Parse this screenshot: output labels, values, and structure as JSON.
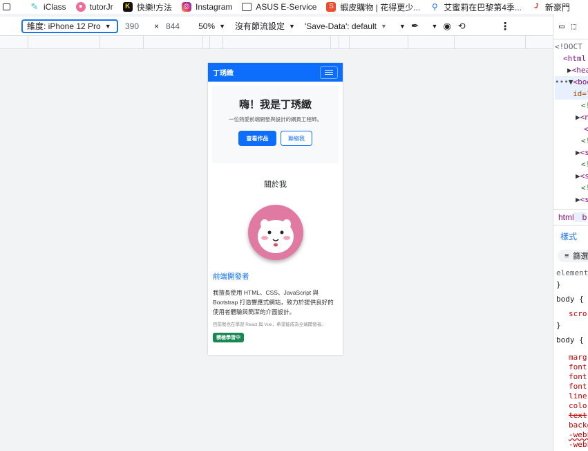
{
  "bookmarks": [
    {
      "label": "",
      "icon": "window-icon",
      "color": "#5f6368"
    },
    {
      "label": "iClass",
      "icon": "iclass-icon",
      "color": "#3db8c8"
    },
    {
      "label": "tutorJr",
      "icon": "tutorjr-icon",
      "color": "#f06a9b"
    },
    {
      "label": "快樂!方法",
      "icon": "kuaile-icon",
      "color": "#222222"
    },
    {
      "label": "Instagram",
      "icon": "instagram-icon",
      "color": "#d6297c"
    },
    {
      "label": "ASUS E-Service",
      "icon": "folder-icon",
      "color": "#5f6368"
    },
    {
      "label": "蝦皮購物 | 花得更少...",
      "icon": "shopee-icon",
      "color": "#ee4d2d"
    },
    {
      "label": "艾蜜莉在巴黎第4季...",
      "icon": "search-icon",
      "color": "#1a73e8"
    },
    {
      "label": "新豪門",
      "icon": "j-icon",
      "color": "#d93025"
    }
  ],
  "device_toolbar": {
    "dimension_label": "維度: iPhone 12 Pro",
    "width": "390",
    "times": "×",
    "height": "844",
    "zoom": "50%",
    "throttle": "沒有節流設定",
    "save_data": "'Save-Data': default"
  },
  "page": {
    "brand": "丁琇緻",
    "hero_title": "嗨！我是丁琇緻",
    "hero_subtitle": "一位熱愛前端開發與設計的網頁工程師。",
    "btn_portfolio": "查看作品",
    "btn_contact": "聯絡我",
    "about_title": "關於我",
    "role": "前端開發者",
    "description": "我擅長使用 HTML、CSS、JavaScript 與 Bootstrap 打造響應式網站，致力於提供良好的使用者體驗與簡潔的介面設計。",
    "note": "目前我也在學習 React 與 Vue，希望能成為全端開發者。",
    "badge": "積極學習中",
    "colors": {
      "primary": "#0d6efd",
      "success": "#198754",
      "avatar_bg": "#e07aa2"
    }
  },
  "devtools": {
    "lines": [
      "<!DOCT",
      "<html",
      "<hea",
      "<bod",
      "id=\"",
      "<!",
      "<n",
      "</",
      "<!",
      "<s",
      "<!",
      "<s",
      "<!",
      "<s"
    ],
    "tab_html": "html",
    "tab_b": "b",
    "styles_tab": "樣式",
    "filter": "篩選",
    "rules": [
      "element",
      "}",
      "body {",
      "scro",
      "}",
      "body {",
      "marg",
      "font",
      "font",
      "font",
      "line",
      "colo",
      "text",
      "backg",
      "-webk",
      "-webk"
    ]
  }
}
